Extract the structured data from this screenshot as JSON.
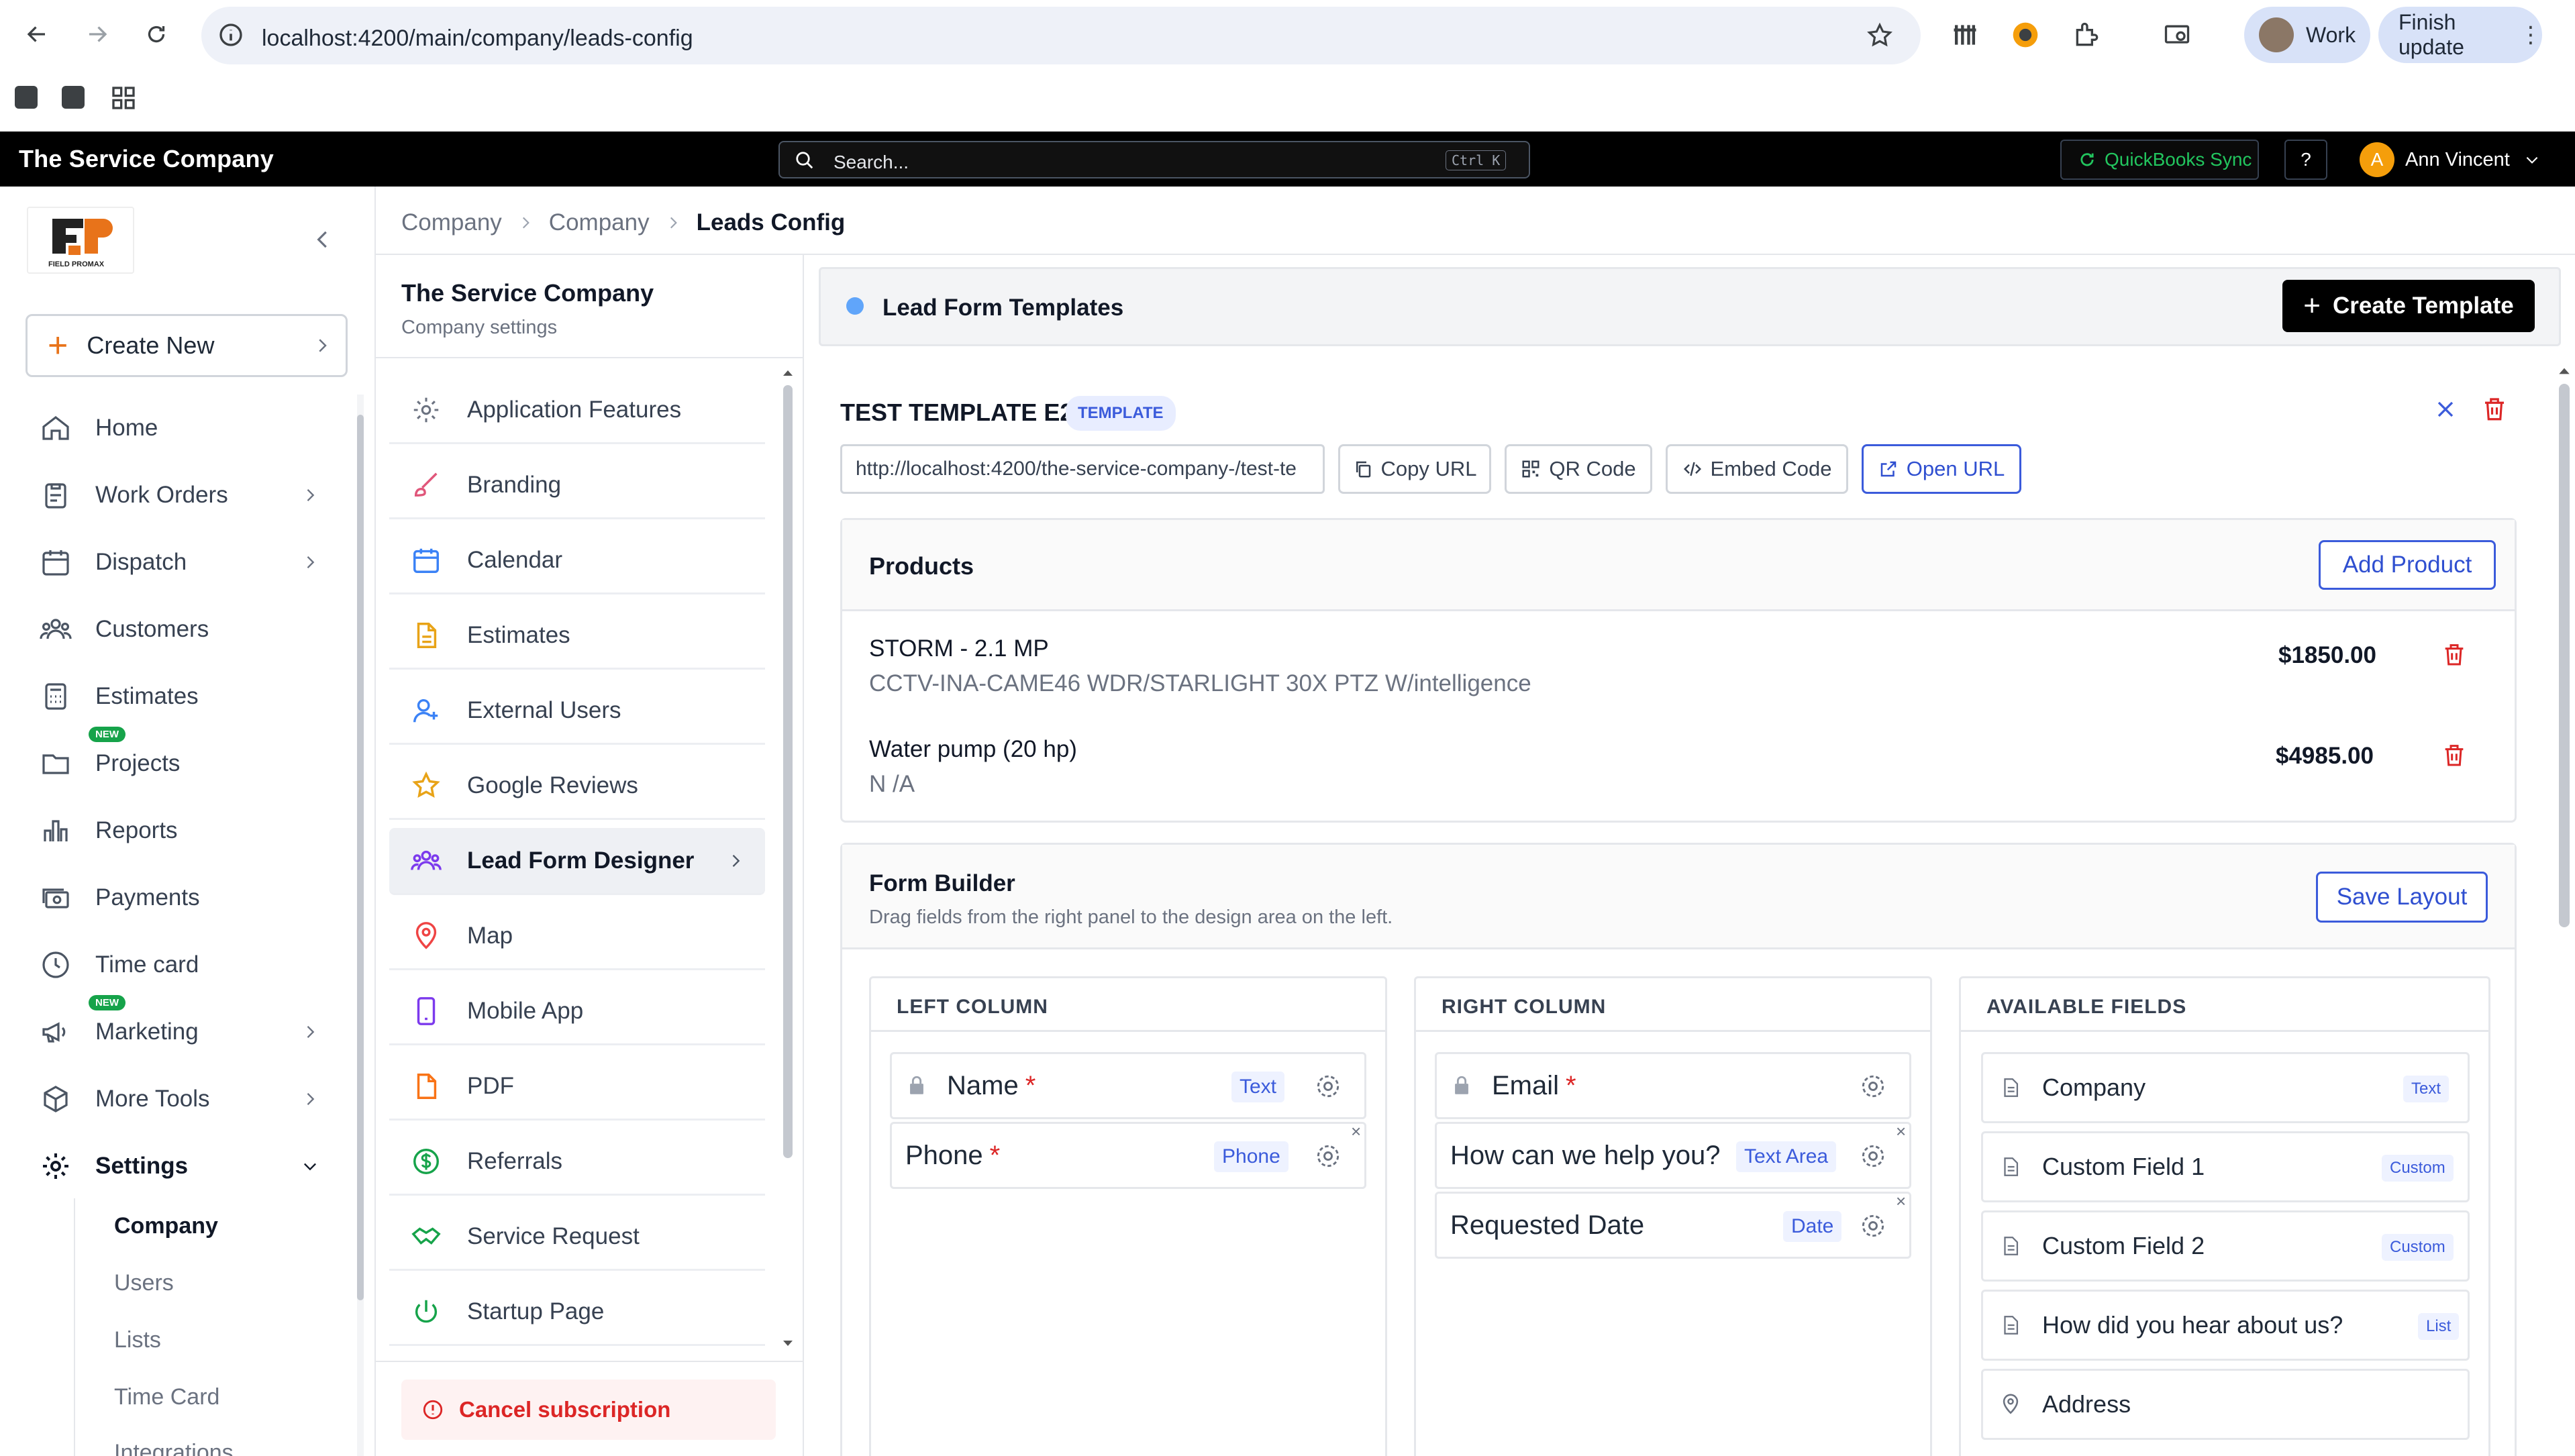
{
  "browser": {
    "url": "localhost:4200/main/company/leads-config",
    "profile_label": "Work",
    "update_label": "Finish update"
  },
  "app": {
    "title": "The Service Company",
    "search_placeholder": "Search...",
    "search_shortcut": "Ctrl K",
    "quickbooks_label": "QuickBooks Sync",
    "help_label": "?",
    "user_initial": "A",
    "user_name": "Ann Vincent"
  },
  "sidebar": {
    "logo_text": "FIELD PROMAX",
    "create_new_label": "Create New",
    "items": [
      {
        "label": "Home",
        "icon": "home-icon"
      },
      {
        "label": "Work Orders",
        "icon": "clipboard-icon"
      },
      {
        "label": "Dispatch",
        "icon": "calendar-icon"
      },
      {
        "label": "Customers",
        "icon": "users-icon"
      },
      {
        "label": "Estimates",
        "icon": "calculator-icon"
      },
      {
        "label": "Projects",
        "icon": "folder-icon",
        "badge": "NEW"
      },
      {
        "label": "Reports",
        "icon": "bar-chart-icon"
      },
      {
        "label": "Payments",
        "icon": "money-icon"
      },
      {
        "label": "Time card",
        "icon": "clock-icon"
      },
      {
        "label": "Marketing",
        "icon": "megaphone-icon",
        "badge": "NEW"
      },
      {
        "label": "More Tools",
        "icon": "box-icon"
      },
      {
        "label": "Settings",
        "icon": "gear-icon"
      }
    ],
    "settings_sub": [
      "Company",
      "Users",
      "Lists",
      "Time Card",
      "Integrations"
    ]
  },
  "breadcrumb": [
    "Company",
    "Company",
    "Leads Config"
  ],
  "settings_panel": {
    "title": "The Service Company",
    "subtitle": "Company settings",
    "items": [
      {
        "label": "Application Features",
        "icon": "gear-icon"
      },
      {
        "label": "Branding",
        "icon": "brush-icon"
      },
      {
        "label": "Calendar",
        "icon": "calendar-icon"
      },
      {
        "label": "Estimates",
        "icon": "document-icon"
      },
      {
        "label": "External Users",
        "icon": "user-plus-icon"
      },
      {
        "label": "Google Reviews",
        "icon": "star-icon"
      },
      {
        "label": "Lead Form Designer",
        "icon": "users-icon"
      },
      {
        "label": "Map",
        "icon": "map-pin-icon"
      },
      {
        "label": "Mobile App",
        "icon": "phone-icon"
      },
      {
        "label": "PDF",
        "icon": "pdf-icon"
      },
      {
        "label": "Referrals",
        "icon": "dollar-icon"
      },
      {
        "label": "Service Request",
        "icon": "handshake-icon"
      },
      {
        "label": "Startup Page",
        "icon": "power-icon"
      }
    ],
    "cancel_label": "Cancel subscription"
  },
  "templates": {
    "header": "Lead Form Templates",
    "create_label": "Create Template",
    "template_name": "TEST TEMPLATE E2E",
    "template_badge": "TEMPLATE",
    "url_value": "http://localhost:4200/the-service-company-/test-te",
    "copy_url": "Copy URL",
    "qr_code": "QR Code",
    "embed_code": "Embed Code",
    "open_url": "Open URL"
  },
  "products": {
    "title": "Products",
    "add_label": "Add Product",
    "items": [
      {
        "name": "STORM - 2.1 MP",
        "desc": "CCTV-INA-CAME46 WDR/STARLIGHT 30X PTZ W/intelligence",
        "price": "$1850.00"
      },
      {
        "name": "Water pump (20 hp)",
        "desc": "N /A",
        "price": "$4985.00"
      }
    ]
  },
  "form_builder": {
    "title": "Form Builder",
    "subtitle": "Drag fields from the right panel to the design area on the left.",
    "save_label": "Save Layout",
    "left_col": {
      "title": "LEFT COLUMN",
      "fields": [
        {
          "label": "Name",
          "required": "*",
          "type": "Text"
        },
        {
          "label": "Phone",
          "required": "*",
          "type": "Phone"
        }
      ]
    },
    "right_col": {
      "title": "RIGHT COLUMN",
      "fields": [
        {
          "label": "Email",
          "required": "*"
        },
        {
          "label": "How can we help you?",
          "type": "Text Area"
        },
        {
          "label": "Requested Date",
          "type": "Date"
        }
      ]
    },
    "available": {
      "title": "AVAILABLE FIELDS",
      "fields": [
        {
          "label": "Company",
          "type": "Text"
        },
        {
          "label": "Custom Field 1",
          "type": "Custom"
        },
        {
          "label": "Custom Field 2",
          "type": "Custom"
        },
        {
          "label": "How did you hear about us?",
          "type": "List"
        },
        {
          "label": "Address"
        }
      ]
    }
  },
  "colors": {
    "accent_blue": "#3b5bdb",
    "danger": "#dc2626",
    "topbar": "#000000",
    "quickbooks_green": "#22c55e"
  }
}
